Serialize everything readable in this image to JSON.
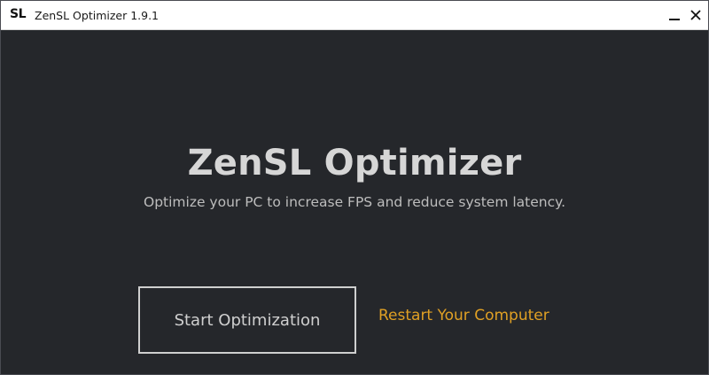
{
  "titlebar": {
    "logo": "SL",
    "title": "ZenSL Optimizer 1.9.1",
    "minimize_icon": "minimize-icon",
    "close_icon": "close-icon"
  },
  "main": {
    "heading": "ZenSL Optimizer",
    "subtitle": "Optimize your PC to increase FPS and reduce system latency.",
    "start_button_label": "Start Optimization",
    "restart_link_label": "Restart Your Computer"
  },
  "colors": {
    "background": "#25272b",
    "titlebar": "#ffffff",
    "heading_text": "#d6d6d6",
    "accent_link": "#e0a024",
    "button_border": "#cfcfcf"
  }
}
